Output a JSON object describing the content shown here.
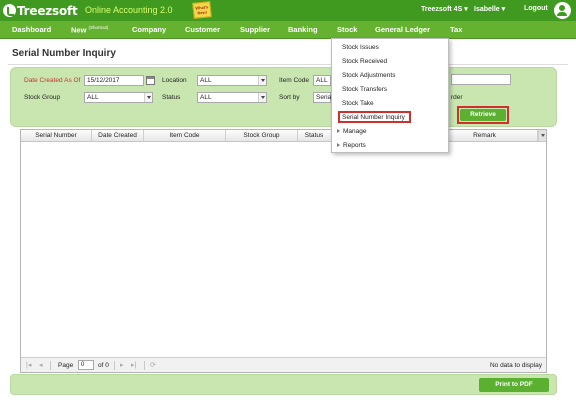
{
  "header": {
    "logo_text": "Treezsoft",
    "app_title": "Online Accounting 2.0",
    "whats_new": "What's New!",
    "company": "Treezsoft 4S",
    "user": "Isabelle",
    "logout": "Logout"
  },
  "nav": {
    "dashboard": "Dashboard",
    "new": "New",
    "new_shortcut": "(Shortcut)",
    "company": "Company",
    "customer": "Customer",
    "supplier": "Supplier",
    "banking": "Banking",
    "stock": "Stock",
    "general_ledger": "General Ledger",
    "tax": "Tax"
  },
  "stock_menu": {
    "items": [
      "Stock Issues",
      "Stock Received",
      "Stock Adjustments",
      "Stock Transfers",
      "Stock Take",
      "Serial Number Inquiry"
    ],
    "manage": "Manage",
    "reports": "Reports",
    "highlighted": "Serial Number Inquiry"
  },
  "page": {
    "title": "Serial Number Inquiry"
  },
  "filters": {
    "date_label": "Date Created As Of",
    "date_value": "15/12/2017",
    "location_label": "Location",
    "location_value": "ALL",
    "item_code_label": "Item Code",
    "item_code_value": "ALL",
    "stock_group_label": "Stock Group",
    "stock_group_value": "ALL",
    "status_label": "Status",
    "status_value": "ALL",
    "sort_by_label": "Sort by",
    "sort_by_value": "Seria",
    "order_label": "rder",
    "retrieve": "Retrieve"
  },
  "grid": {
    "columns": [
      "Serial Number",
      "Date Created",
      "Item Code",
      "Stock Group",
      "Status",
      "Remark"
    ],
    "page_label": "Page",
    "page_value": "0",
    "of_label": "of 0",
    "no_data": "No data to display"
  },
  "footer": {
    "print_pdf": "Print to PDF"
  },
  "colors": {
    "header_green": "#3f9a1f",
    "nav_green": "#64b22f",
    "panel_green": "#c9e6b1",
    "button_green": "#5bb031",
    "highlight_red": "#d0302b"
  }
}
